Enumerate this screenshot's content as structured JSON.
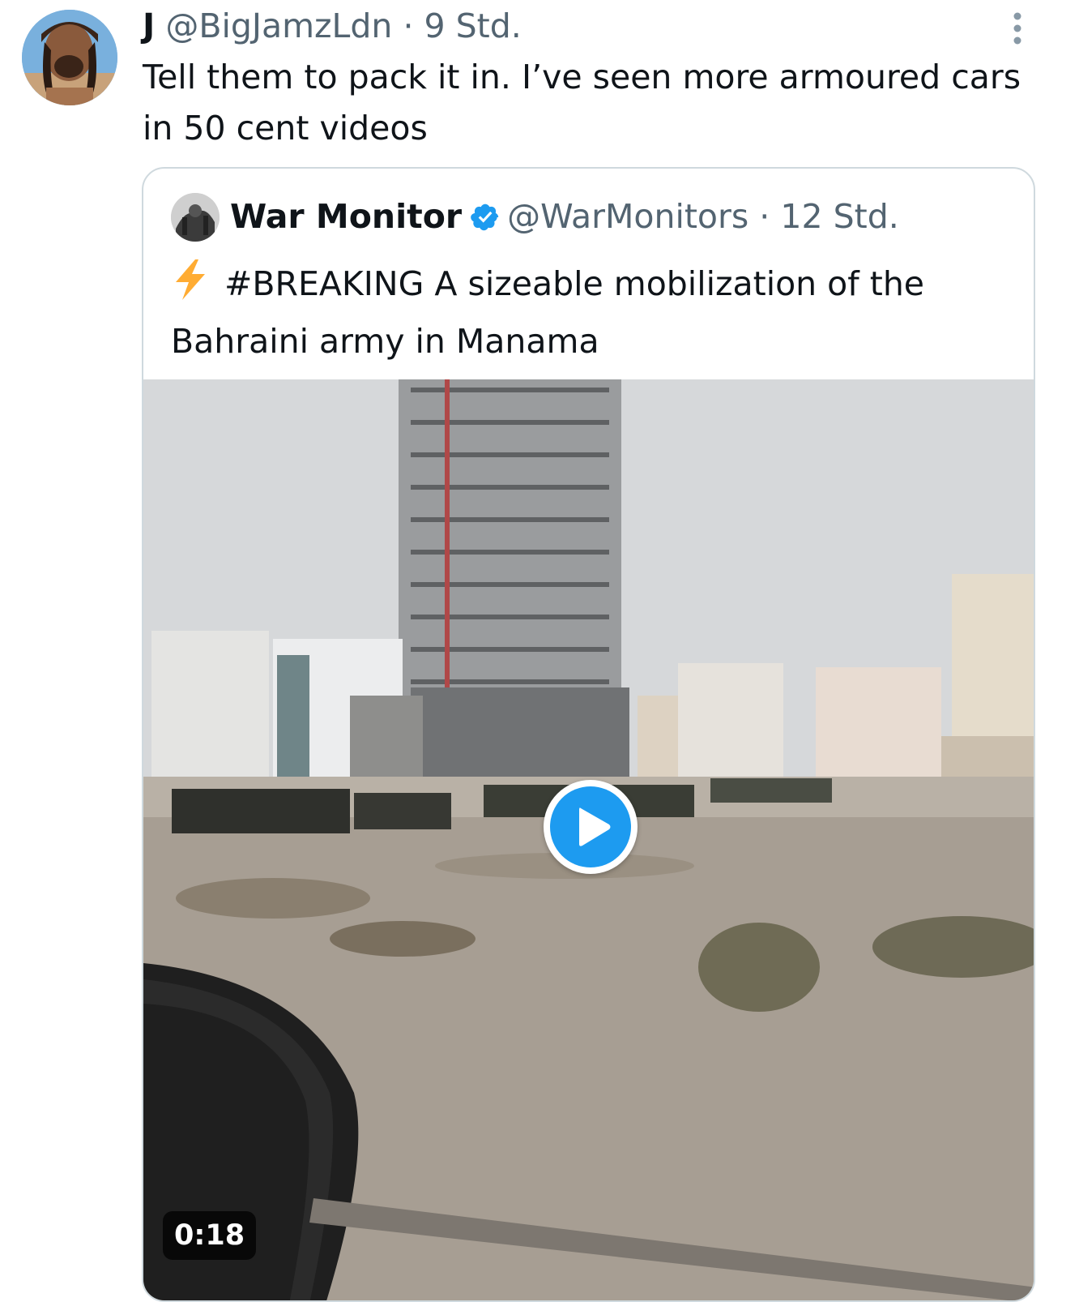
{
  "tweet": {
    "author_name": "J",
    "handle": "@BigJamzLdn",
    "separator": "·",
    "time": "9 Std.",
    "text": "Tell them to pack it in. I’ve seen more armoured cars in 50 cent videos",
    "avatar_icon": "profile-photo"
  },
  "more_menu": {
    "icon": "more-vertical-icon"
  },
  "quoted_tweet": {
    "author_name": "War Monitor",
    "verified_icon": "verified-badge-icon",
    "handle": "@WarMonitors",
    "separator": "·",
    "time": "12 Std.",
    "lead_icon": "lightning-bolt-emoji",
    "text": "#BREAKING A sizeable mobilization of the Bahraini army in Manama",
    "avatar_icon": "profile-photo",
    "media": {
      "type": "video",
      "play_icon": "play-icon",
      "duration": "0:18"
    }
  },
  "colors": {
    "text_primary": "#0f1419",
    "text_muted": "#536471",
    "accent": "#1d9bf0",
    "card_border": "#cfd9de",
    "lightning": "#ffac33"
  }
}
